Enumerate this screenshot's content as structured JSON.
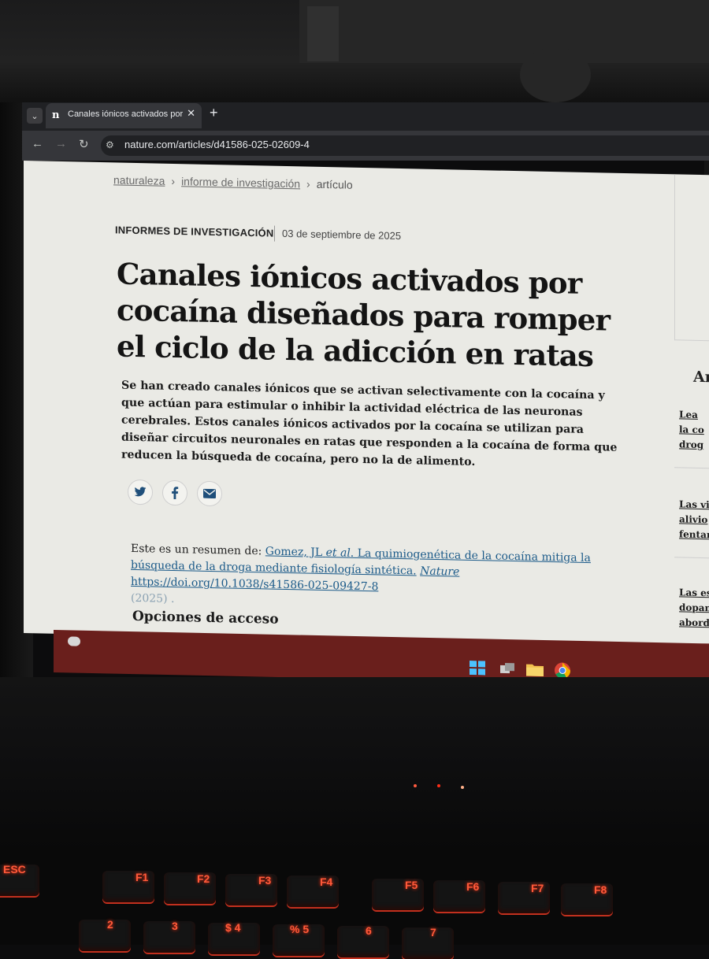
{
  "browser": {
    "tab_title": "Canales iónicos activados por c",
    "favicon": "n",
    "new_tab_label": "+",
    "close_label": "✕",
    "url": "nature.com/articles/d41586-025-02609-4"
  },
  "breadcrumbs": [
    "naturaleza",
    "informe de investigación",
    "artículo"
  ],
  "article": {
    "kicker": "INFORMES DE INVESTIGACIÓN",
    "date": "03 de septiembre de 2025",
    "title": "Canales iónicos activados por cocaína diseñados para romper el ciclo de la adicción en ratas",
    "standfirst": "Se han creado canales iónicos que se activan selectivamente con la cocaína y que actúan para estimular o inhibir la actividad eléctrica de las neuronas cerebrales. Estos canales iónicos activados por la cocaína se utilizan para diseñar circuitos neuronales en ratas que responden a la cocaína de forma que reducen la búsqueda de cocaína, pero no la de alimento.",
    "summary_prefix": "Este es un resumen de:",
    "summary_authors": "Gomez, JL",
    "summary_etal": "et al",
    "summary_title": ". La quimiogenética de la cocaína mitiga la búsqueda de la droga mediante fisiología sintética.",
    "summary_journal": "Nature",
    "summary_doi": "https://doi.org/10.1038/s41586-025-09427-8",
    "summary_year": "(2025) .",
    "access_heading": "Opciones de acceso"
  },
  "share": {
    "twitter_icon": "twitter-icon",
    "facebook_icon": "facebook-icon",
    "email_icon": "email-icon"
  },
  "rail": {
    "heading": "Ar",
    "items": [
      [
        "Lea",
        "la co",
        "drog"
      ],
      [
        "Las vi",
        "alivio",
        "fentan"
      ],
      [
        "Las estr",
        "dopami",
        "abordar"
      ]
    ]
  },
  "colors": {
    "link": "#1b5a89",
    "taskbar": "#6a1f1c",
    "keyboard_backlight": "#ff3b1f"
  },
  "keyboard": {
    "keys": [
      "ESC",
      "F1",
      "F2",
      "F3",
      "F4",
      "F5",
      "F6",
      "F7",
      "F8",
      "2",
      "3",
      "$ 4",
      "% 5",
      "6",
      "7"
    ]
  }
}
